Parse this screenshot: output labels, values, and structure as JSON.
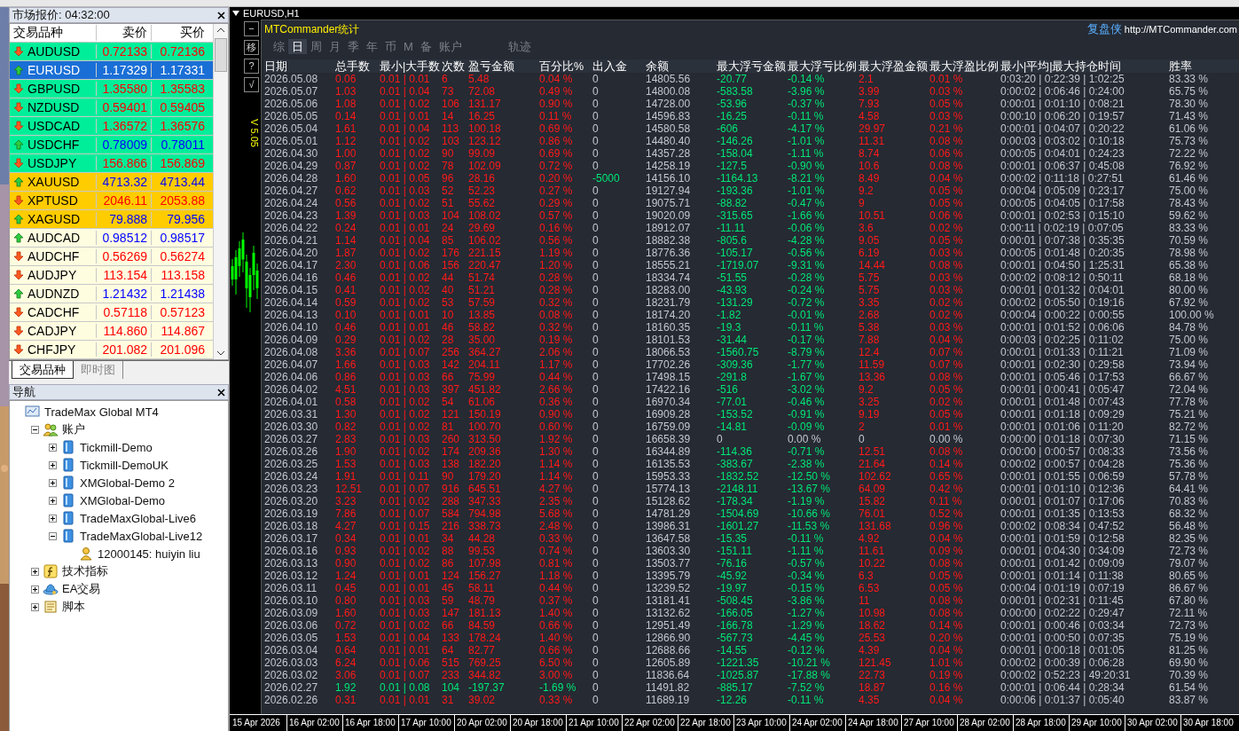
{
  "market_watch": {
    "title": "市场报价: 04:32:00",
    "columns": [
      "交易品种",
      "卖价",
      "买价"
    ],
    "rows": [
      {
        "symbol": "AUDUSD",
        "bid": "0.72133",
        "ask": "0.72136",
        "kind": "down",
        "color": "#00ee99",
        "selected": false
      },
      {
        "symbol": "EURUSD",
        "bid": "1.17329",
        "ask": "1.17331",
        "kind": "up",
        "selected": true
      },
      {
        "symbol": "GBPUSD",
        "bid": "1.35580",
        "ask": "1.35583",
        "kind": "down",
        "color": "#00ee99",
        "selected": false
      },
      {
        "symbol": "NZDUSD",
        "bid": "0.59401",
        "ask": "0.59405",
        "kind": "down",
        "color": "#00ee99",
        "selected": false
      },
      {
        "symbol": "USDCAD",
        "bid": "1.36572",
        "ask": "1.36576",
        "kind": "down",
        "color": "#00ee99",
        "selected": false
      },
      {
        "symbol": "USDCHF",
        "bid": "0.78009",
        "ask": "0.78011",
        "kind": "up",
        "color": "#00ee99",
        "selected": false
      },
      {
        "symbol": "USDJPY",
        "bid": "156.866",
        "ask": "156.869",
        "kind": "down",
        "color": "#00ee99",
        "selected": false
      },
      {
        "symbol": "XAUUSD",
        "bid": "4713.32",
        "ask": "4713.44",
        "kind": "up",
        "color": "#ffcc00",
        "selected": false
      },
      {
        "symbol": "XPTUSD",
        "bid": "2046.11",
        "ask": "2053.88",
        "kind": "down",
        "color": "#ffcc00",
        "selected": false
      },
      {
        "symbol": "XAGUSD",
        "bid": "79.888",
        "ask": "79.956",
        "kind": "up",
        "color": "#ffcc00",
        "selected": false
      },
      {
        "symbol": "AUDCAD",
        "bid": "0.98512",
        "ask": "0.98517",
        "kind": "up",
        "color": "#fffde0",
        "selected": false
      },
      {
        "symbol": "AUDCHF",
        "bid": "0.56269",
        "ask": "0.56274",
        "kind": "down",
        "color": "#fffde0",
        "selected": false
      },
      {
        "symbol": "AUDJPY",
        "bid": "113.154",
        "ask": "113.158",
        "kind": "down",
        "color": "#fffde0",
        "selected": false
      },
      {
        "symbol": "AUDNZD",
        "bid": "1.21432",
        "ask": "1.21438",
        "kind": "up",
        "color": "#fffde0",
        "selected": false
      },
      {
        "symbol": "CADCHF",
        "bid": "0.57118",
        "ask": "0.57123",
        "kind": "down",
        "color": "#fffde0",
        "selected": false
      },
      {
        "symbol": "CADJPY",
        "bid": "114.860",
        "ask": "114.867",
        "kind": "down",
        "color": "#fffde0",
        "selected": false
      },
      {
        "symbol": "CHFJPY",
        "bid": "201.082",
        "ask": "201.096",
        "kind": "down",
        "color": "#fffde0",
        "selected": false
      }
    ],
    "tabs": [
      {
        "label": "交易品种",
        "selected": true
      },
      {
        "label": "即时图",
        "selected": false
      }
    ]
  },
  "navigator": {
    "title": "导航",
    "tree": [
      {
        "label": "TradeMax Global MT4",
        "kind": "terminal",
        "children": [
          {
            "label": "账户",
            "kind": "accounts",
            "expanded": true,
            "children": [
              {
                "label": "Tickmill-Demo",
                "kind": "server",
                "expanded": false
              },
              {
                "label": "Tickmill-DemoUK",
                "kind": "server",
                "expanded": false
              },
              {
                "label": "XMGlobal-Demo 2",
                "kind": "server",
                "expanded": false
              },
              {
                "label": "XMGlobal-Demo",
                "kind": "server",
                "expanded": false
              },
              {
                "label": "TradeMaxGlobal-Live6",
                "kind": "server",
                "expanded": false
              },
              {
                "label": "TradeMaxGlobal-Live12",
                "kind": "server",
                "expanded": true,
                "children": [
                  {
                    "label": "12000145: huiyin liu",
                    "kind": "user"
                  }
                ]
              }
            ]
          },
          {
            "label": "技术指标",
            "kind": "indicators",
            "expanded": false
          },
          {
            "label": "EA交易",
            "kind": "experts",
            "expanded": false
          },
          {
            "label": "脚本",
            "kind": "scripts",
            "expanded": false
          }
        ]
      }
    ]
  },
  "chart": {
    "title": "EURUSD,H1",
    "side_buttons": [
      "−",
      "移",
      "?",
      "√"
    ],
    "version": "V 5.05",
    "time_axis": [
      "15 Apr 2026",
      "16 Apr 02:00",
      "16 Apr 18:00",
      "17 Apr 10:00",
      "20 Apr 02:00",
      "20 Apr 18:00",
      "21 Apr 10:00",
      "22 Apr 02:00",
      "22 Apr 18:00",
      "23 Apr 10:00",
      "24 Apr 02:00",
      "24 Apr 18:00",
      "27 Apr 10:00",
      "28 Apr 02:00",
      "28 Apr 18:00",
      "29 Apr 10:00",
      "30 Apr 02:00",
      "30 Apr 18:00"
    ]
  },
  "stats": {
    "title": "MTCommander统计",
    "brand": "复盘侠",
    "link": "http://MTCommander.com",
    "tabs": [
      {
        "label": "综",
        "selected": false
      },
      {
        "label": "日",
        "selected": true
      },
      {
        "label": "周",
        "selected": false
      },
      {
        "label": "月",
        "selected": false
      },
      {
        "label": "季",
        "selected": false
      },
      {
        "label": "年",
        "selected": false
      },
      {
        "label": "币",
        "selected": false
      },
      {
        "label": "M",
        "selected": false
      },
      {
        "label": "备",
        "selected": false
      },
      {
        "label": "账户",
        "selected": false
      },
      {
        "label": "轨迹",
        "selected": false
      }
    ],
    "columns": [
      "日期",
      "总手数",
      "最小|大手数",
      "次数",
      "盈亏金额",
      "百分比%",
      "出入金",
      "余额",
      "最大浮亏金额",
      "最大浮亏比例",
      "最大浮盈金额",
      "最大浮盈比例",
      "最小|平均|最大持仓时间",
      "胜率"
    ],
    "rows": [
      {
        "cells": [
          "2026.05.08",
          "0.06",
          "0.01 | 0.01",
          "6",
          "5.48",
          "0.04 %",
          "0",
          "14805.56",
          "-20.77",
          "-0.14 %",
          "2.1",
          "0.01 %",
          "0:03:20 | 0:22:39 | 1:02:25",
          "83.33 %"
        ],
        "kind": "gain"
      },
      {
        "cells": [
          "2026.05.07",
          "1.03",
          "0.01 | 0.04",
          "73",
          "72.08",
          "0.49 %",
          "0",
          "14800.08",
          "-583.58",
          "-3.96 %",
          "3.99",
          "0.03 %",
          "0:00:02 | 0:06:46 | 0:24:00",
          "65.75 %"
        ],
        "kind": "gain"
      },
      {
        "cells": [
          "2026.05.06",
          "1.08",
          "0.01 | 0.02",
          "106",
          "131.17",
          "0.90 %",
          "0",
          "14728.00",
          "-53.96",
          "-0.37 %",
          "7.93",
          "0.05 %",
          "0:00:01 | 0:01:10 | 0:08:21",
          "78.30 %"
        ],
        "kind": "gain"
      },
      {
        "cells": [
          "2026.05.05",
          "0.14",
          "0.01 | 0.01",
          "14",
          "16.25",
          "0.11 %",
          "0",
          "14596.83",
          "-16.25",
          "-0.11 %",
          "4.58",
          "0.03 %",
          "0:00:10 | 0:06:20 | 0:19:57",
          "71.43 %"
        ],
        "kind": "gain"
      },
      {
        "cells": [
          "2026.05.04",
          "1.61",
          "0.01 | 0.04",
          "113",
          "100.18",
          "0.69 %",
          "0",
          "14580.58",
          "-606",
          "-4.17 %",
          "29.97",
          "0.21 %",
          "0:00:01 | 0:04:07 | 0:20:22",
          "61.06 %"
        ],
        "kind": "gain"
      },
      {
        "cells": [
          "2026.05.01",
          "1.12",
          "0.01 | 0.02",
          "103",
          "123.12",
          "0.86 %",
          "0",
          "14480.40",
          "-146.26",
          "-1.01 %",
          "11.31",
          "0.08 %",
          "0:00:03 | 0:03:02 | 0:10:18",
          "75.73 %"
        ],
        "kind": "gain"
      },
      {
        "cells": [
          "2026.04.30",
          "1.00",
          "0.01 | 0.02",
          "90",
          "99.09",
          "0.69 %",
          "0",
          "14357.28",
          "-158.04",
          "-1.11 %",
          "8.74",
          "0.06 %",
          "0:00:05 | 0:04:01 | 0:24:23",
          "72.22 %"
        ],
        "kind": "gain"
      },
      {
        "cells": [
          "2026.04.29",
          "0.87",
          "0.01 | 0.02",
          "78",
          "102.09",
          "0.72 %",
          "0",
          "14258.19",
          "-127.5",
          "-0.90 %",
          "10.6",
          "0.08 %",
          "0:00:01 | 0:06:37 | 0:45:08",
          "76.92 %"
        ],
        "kind": "gain"
      },
      {
        "cells": [
          "2026.04.28",
          "1.60",
          "0.01 | 0.05",
          "96",
          "28.16",
          "0.20 %",
          "-5000",
          "14156.10",
          "-1164.13",
          "-8.21 %",
          "8.49",
          "0.04 %",
          "0:00:02 | 0:11:18 | 0:27:51",
          "61.46 %"
        ],
        "kind": "withdrawal"
      },
      {
        "cells": [
          "2026.04.27",
          "0.62",
          "0.01 | 0.03",
          "52",
          "52.23",
          "0.27 %",
          "0",
          "19127.94",
          "-193.36",
          "-1.01 %",
          "9.2",
          "0.05 %",
          "0:00:04 | 0:05:09 | 0:23:17",
          "75.00 %"
        ],
        "kind": "gain"
      },
      {
        "cells": [
          "2026.04.24",
          "0.56",
          "0.01 | 0.02",
          "51",
          "55.62",
          "0.29 %",
          "0",
          "19075.71",
          "-88.82",
          "-0.47 %",
          "9",
          "0.05 %",
          "0:00:05 | 0:04:05 | 0:17:58",
          "78.43 %"
        ],
        "kind": "gain"
      },
      {
        "cells": [
          "2026.04.23",
          "1.39",
          "0.01 | 0.03",
          "104",
          "108.02",
          "0.57 %",
          "0",
          "19020.09",
          "-315.65",
          "-1.66 %",
          "10.51",
          "0.06 %",
          "0:00:01 | 0:02:53 | 0:15:10",
          "59.62 %"
        ],
        "kind": "gain"
      },
      {
        "cells": [
          "2026.04.22",
          "0.24",
          "0.01 | 0.01",
          "24",
          "29.69",
          "0.16 %",
          "0",
          "18912.07",
          "-11.11",
          "-0.06 %",
          "3.6",
          "0.02 %",
          "0:00:11 | 0:02:19 | 0:07:05",
          "83.33 %"
        ],
        "kind": "gain"
      },
      {
        "cells": [
          "2026.04.21",
          "1.14",
          "0.01 | 0.04",
          "85",
          "106.02",
          "0.56 %",
          "0",
          "18882.38",
          "-805.6",
          "-4.28 %",
          "9.05",
          "0.05 %",
          "0:00:01 | 0:07:38 | 0:35:35",
          "70.59 %"
        ],
        "kind": "gain"
      },
      {
        "cells": [
          "2026.04.20",
          "1.87",
          "0.01 | 0.02",
          "176",
          "221.15",
          "1.19 %",
          "0",
          "18776.36",
          "-105.17",
          "-0.56 %",
          "6.19",
          "0.03 %",
          "0:00:05 | 0:01:48 | 0:20:35",
          "78.98 %"
        ],
        "kind": "gain"
      },
      {
        "cells": [
          "2026.04.17",
          "2.30",
          "0.01 | 0.06",
          "156",
          "220.47",
          "1.20 %",
          "0",
          "18555.21",
          "-1719.07",
          "-9.31 %",
          "14.44",
          "0.08 %",
          "0:00:01 | 0:04:50 | 1:25:31",
          "65.38 %"
        ],
        "kind": "gain"
      },
      {
        "cells": [
          "2026.04.16",
          "0.46",
          "0.01 | 0.02",
          "44",
          "51.74",
          "0.28 %",
          "0",
          "18334.74",
          "-51.55",
          "-0.28 %",
          "5.75",
          "0.03 %",
          "0:00:02 | 0:08:12 | 0:50:11",
          "68.18 %"
        ],
        "kind": "gain"
      },
      {
        "cells": [
          "2026.04.15",
          "0.41",
          "0.01 | 0.02",
          "40",
          "51.21",
          "0.28 %",
          "0",
          "18283.00",
          "-43.93",
          "-0.24 %",
          "5.75",
          "0.03 %",
          "0:00:01 | 0:01:32 | 0:04:01",
          "80.00 %"
        ],
        "kind": "gain"
      },
      {
        "cells": [
          "2026.04.14",
          "0.59",
          "0.01 | 0.02",
          "53",
          "57.59",
          "0.32 %",
          "0",
          "18231.79",
          "-131.29",
          "-0.72 %",
          "3.35",
          "0.02 %",
          "0:00:02 | 0:05:50 | 0:19:16",
          "67.92 %"
        ],
        "kind": "gain"
      },
      {
        "cells": [
          "2026.04.13",
          "0.10",
          "0.01 | 0.01",
          "10",
          "13.85",
          "0.08 %",
          "0",
          "18174.20",
          "-1.82",
          "-0.01 %",
          "2.68",
          "0.02 %",
          "0:00:04 | 0:00:22 | 0:00:55",
          "100.00 %"
        ],
        "kind": "gain"
      },
      {
        "cells": [
          "2026.04.10",
          "0.46",
          "0.01 | 0.01",
          "46",
          "58.82",
          "0.32 %",
          "0",
          "18160.35",
          "-19.3",
          "-0.11 %",
          "5.38",
          "0.03 %",
          "0:00:01 | 0:01:52 | 0:06:06",
          "84.78 %"
        ],
        "kind": "gain"
      },
      {
        "cells": [
          "2026.04.09",
          "0.29",
          "0.01 | 0.02",
          "28",
          "35.00",
          "0.19 %",
          "0",
          "18101.53",
          "-31.44",
          "-0.17 %",
          "7.88",
          "0.04 %",
          "0:00:03 | 0:02:25 | 0:11:02",
          "75.00 %"
        ],
        "kind": "gain"
      },
      {
        "cells": [
          "2026.04.08",
          "3.36",
          "0.01 | 0.07",
          "256",
          "364.27",
          "2.06 %",
          "0",
          "18066.53",
          "-1560.75",
          "-8.79 %",
          "12.4",
          "0.07 %",
          "0:00:01 | 0:01:33 | 0:11:21",
          "71.09 %"
        ],
        "kind": "gain"
      },
      {
        "cells": [
          "2026.04.07",
          "1.66",
          "0.01 | 0.03",
          "142",
          "204.11",
          "1.17 %",
          "0",
          "17702.26",
          "-309.36",
          "-1.77 %",
          "11.59",
          "0.07 %",
          "0:00:01 | 0:02:30 | 0:29:58",
          "73.94 %"
        ],
        "kind": "gain"
      },
      {
        "cells": [
          "2026.04.06",
          "0.86",
          "0.01 | 0.03",
          "66",
          "75.99",
          "0.44 %",
          "0",
          "17498.15",
          "-291.8",
          "-1.67 %",
          "13.36",
          "0.08 %",
          "0:00:01 | 0:05:46 | 0:17:53",
          "66.67 %"
        ],
        "kind": "gain"
      },
      {
        "cells": [
          "2026.04.02",
          "4.51",
          "0.01 | 0.03",
          "397",
          "451.82",
          "2.66 %",
          "0",
          "17422.16",
          "-516",
          "-3.02 %",
          "9.2",
          "0.05 %",
          "0:00:01 | 0:00:41 | 0:05:47",
          "72.04 %"
        ],
        "kind": "gain"
      },
      {
        "cells": [
          "2026.04.01",
          "0.58",
          "0.01 | 0.02",
          "54",
          "61.06",
          "0.36 %",
          "0",
          "16970.34",
          "-77.01",
          "-0.46 %",
          "3.25",
          "0.02 %",
          "0:00:01 | 0:01:48 | 0:07:43",
          "77.78 %"
        ],
        "kind": "gain"
      },
      {
        "cells": [
          "2026.03.31",
          "1.30",
          "0.01 | 0.02",
          "121",
          "150.19",
          "0.90 %",
          "0",
          "16909.28",
          "-153.52",
          "-0.91 %",
          "9.19",
          "0.05 %",
          "0:00:01 | 0:01:18 | 0:09:29",
          "75.21 %"
        ],
        "kind": "gain"
      },
      {
        "cells": [
          "2026.03.30",
          "0.82",
          "0.01 | 0.02",
          "81",
          "100.70",
          "0.60 %",
          "0",
          "16759.09",
          "-14.81",
          "-0.09 %",
          "2",
          "0.01 %",
          "0:00:01 | 0:01:06 | 0:11:20",
          "82.72 %"
        ],
        "kind": "gain"
      },
      {
        "cells": [
          "2026.03.27",
          "2.83",
          "0.01 | 0.03",
          "260",
          "313.50",
          "1.92 %",
          "0",
          "16658.39",
          "0",
          "0.00 %",
          "0",
          "0.00 %",
          "0:00:00 | 0:01:18 | 0:07:30",
          "71.15 %"
        ],
        "kind": "flat"
      },
      {
        "cells": [
          "2026.03.26",
          "1.90",
          "0.01 | 0.02",
          "174",
          "209.36",
          "1.30 %",
          "0",
          "16344.89",
          "-114.36",
          "-0.71 %",
          "12.51",
          "0.08 %",
          "0:00:00 | 0:00:57 | 0:08:33",
          "73.56 %"
        ],
        "kind": "gain"
      },
      {
        "cells": [
          "2026.03.25",
          "1.53",
          "0.01 | 0.03",
          "138",
          "182.20",
          "1.14 %",
          "0",
          "16135.53",
          "-383.67",
          "-2.38 %",
          "21.64",
          "0.14 %",
          "0:00:02 | 0:00:57 | 0:04:28",
          "75.36 %"
        ],
        "kind": "gain"
      },
      {
        "cells": [
          "2026.03.24",
          "1.91",
          "0.01 | 0.11",
          "90",
          "179.20",
          "1.14 %",
          "0",
          "15953.33",
          "-1832.52",
          "-12.50 %",
          "102.62",
          "0.65 %",
          "0:00:01 | 0:01:55 | 0:06:59",
          "57.78 %"
        ],
        "kind": "gain"
      },
      {
        "cells": [
          "2026.03.23",
          "12.51",
          "0.01 | 0.07",
          "916",
          "645.51",
          "4.27 %",
          "0",
          "15774.13",
          "-2148.11",
          "-13.67 %",
          "64.09",
          "0.42 %",
          "0:00:01 | 0:01:10 | 0:12:36",
          "64.41 %"
        ],
        "kind": "gain"
      },
      {
        "cells": [
          "2026.03.20",
          "3.23",
          "0.01 | 0.02",
          "288",
          "347.33",
          "2.35 %",
          "0",
          "15128.62",
          "-178.34",
          "-1.19 %",
          "15.82",
          "0.11 %",
          "0:00:01 | 0:01:07 | 0:17:06",
          "70.83 %"
        ],
        "kind": "gain"
      },
      {
        "cells": [
          "2026.03.19",
          "7.86",
          "0.01 | 0.07",
          "584",
          "794.98",
          "5.68 %",
          "0",
          "14781.29",
          "-1504.69",
          "-10.66 %",
          "76.01",
          "0.52 %",
          "0:00:01 | 0:01:35 | 0:13:53",
          "68.32 %"
        ],
        "kind": "gain"
      },
      {
        "cells": [
          "2026.03.18",
          "4.27",
          "0.01 | 0.15",
          "216",
          "338.73",
          "2.48 %",
          "0",
          "13986.31",
          "-1601.27",
          "-11.53 %",
          "131.68",
          "0.96 %",
          "0:00:02 | 0:08:34 | 0:47:52",
          "56.48 %"
        ],
        "kind": "gain"
      },
      {
        "cells": [
          "2026.03.17",
          "0.34",
          "0.01 | 0.01",
          "34",
          "44.28",
          "0.33 %",
          "0",
          "13647.58",
          "-15.35",
          "-0.11 %",
          "4.92",
          "0.04 %",
          "0:00:01 | 0:01:59 | 0:12:58",
          "82.35 %"
        ],
        "kind": "gain"
      },
      {
        "cells": [
          "2026.03.16",
          "0.93",
          "0.01 | 0.02",
          "88",
          "99.53",
          "0.74 %",
          "0",
          "13603.30",
          "-151.11",
          "-1.11 %",
          "11.61",
          "0.09 %",
          "0:00:01 | 0:04:30 | 0:34:09",
          "72.73 %"
        ],
        "kind": "gain"
      },
      {
        "cells": [
          "2026.03.13",
          "0.90",
          "0.01 | 0.02",
          "86",
          "107.98",
          "0.81 %",
          "0",
          "13503.77",
          "-76.16",
          "-0.57 %",
          "10.22",
          "0.08 %",
          "0:00:01 | 0:01:42 | 0:09:09",
          "79.07 %"
        ],
        "kind": "gain"
      },
      {
        "cells": [
          "2026.03.12",
          "1.24",
          "0.01 | 0.01",
          "124",
          "156.27",
          "1.18 %",
          "0",
          "13395.79",
          "-45.92",
          "-0.34 %",
          "6.3",
          "0.05 %",
          "0:00:01 | 0:01:14 | 0:11:38",
          "80.65 %"
        ],
        "kind": "gain"
      },
      {
        "cells": [
          "2026.03.11",
          "0.45",
          "0.01 | 0.01",
          "45",
          "58.11",
          "0.44 %",
          "0",
          "13239.52",
          "-19.97",
          "-0.15 %",
          "6.53",
          "0.05 %",
          "0:00:04 | 0:01:19 | 0:07:19",
          "86.67 %"
        ],
        "kind": "gain"
      },
      {
        "cells": [
          "2026.03.10",
          "0.80",
          "0.01 | 0.03",
          "59",
          "48.79",
          "0.37 %",
          "0",
          "13181.41",
          "-508.45",
          "-3.86 %",
          "11",
          "0.08 %",
          "0:00:01 | 0:02:31 | 0:11:45",
          "67.80 %"
        ],
        "kind": "gain"
      },
      {
        "cells": [
          "2026.03.09",
          "1.60",
          "0.01 | 0.03",
          "147",
          "181.13",
          "1.40 %",
          "0",
          "13132.62",
          "-166.05",
          "-1.27 %",
          "10.98",
          "0.08 %",
          "0:00:00 | 0:02:22 | 0:29:47",
          "72.11 %"
        ],
        "kind": "gain"
      },
      {
        "cells": [
          "2026.03.06",
          "0.72",
          "0.01 | 0.02",
          "66",
          "84.59",
          "0.66 %",
          "0",
          "12951.49",
          "-166.78",
          "-1.29 %",
          "18.62",
          "0.14 %",
          "0:00:01 | 0:00:46 | 0:03:34",
          "72.73 %"
        ],
        "kind": "gain"
      },
      {
        "cells": [
          "2026.03.05",
          "1.53",
          "0.01 | 0.04",
          "133",
          "178.24",
          "1.40 %",
          "0",
          "12866.90",
          "-567.73",
          "-4.45 %",
          "25.53",
          "0.20 %",
          "0:00:01 | 0:00:50 | 0:07:35",
          "75.19 %"
        ],
        "kind": "gain"
      },
      {
        "cells": [
          "2026.03.04",
          "0.64",
          "0.01 | 0.01",
          "64",
          "82.77",
          "0.66 %",
          "0",
          "12688.66",
          "-14.55",
          "-0.12 %",
          "4.39",
          "0.04 %",
          "0:00:01 | 0:00:18 | 0:01:05",
          "81.25 %"
        ],
        "kind": "gain"
      },
      {
        "cells": [
          "2026.03.03",
          "6.24",
          "0.01 | 0.06",
          "515",
          "769.25",
          "6.50 %",
          "0",
          "12605.89",
          "-1221.35",
          "-10.21 %",
          "121.45",
          "1.01 %",
          "0:00:02 | 0:00:39 | 0:06:28",
          "69.90 %"
        ],
        "kind": "gain"
      },
      {
        "cells": [
          "2026.03.02",
          "3.06",
          "0.01 | 0.07",
          "233",
          "344.82",
          "3.00 %",
          "0",
          "11836.64",
          "-1025.87",
          "-17.88 %",
          "22.73",
          "0.19 %",
          "0:00:02 | 0:52:23 | 49:20:31",
          "70.39 %"
        ],
        "kind": "gain"
      },
      {
        "cells": [
          "2026.02.27",
          "1.92",
          "0.01 | 0.08",
          "104",
          "-197.37",
          "-1.69 %",
          "0",
          "11491.82",
          "-885.17",
          "-7.52 %",
          "18.87",
          "0.16 %",
          "0:00:01 | 0:06:44 | 0:28:34",
          "61.54 %"
        ],
        "kind": "loss"
      },
      {
        "cells": [
          "2026.02.26",
          "0.31",
          "0.01 | 0.01",
          "31",
          "39.02",
          "0.33 %",
          "0",
          "11689.19",
          "-12.26",
          "-0.11 %",
          "4.35",
          "0.04 %",
          "0:00:06 | 0:01:37 | 0:05:40",
          "83.87 %"
        ],
        "kind": "gain"
      }
    ]
  }
}
